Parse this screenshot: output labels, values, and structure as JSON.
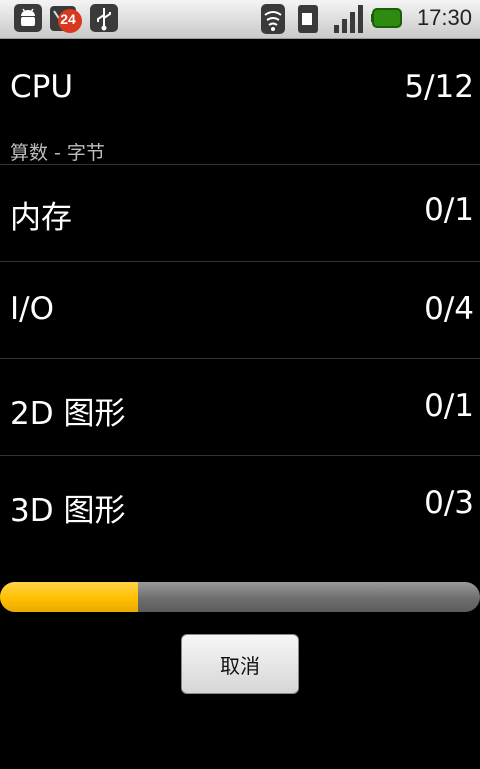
{
  "status_bar": {
    "notification_count": "24",
    "time": "17:30"
  },
  "rows": [
    {
      "label": "CPU",
      "value": "5/12"
    },
    {
      "label": "内存",
      "value": "0/1"
    },
    {
      "label": "I/O",
      "value": "0/4"
    },
    {
      "label": "2D 图形",
      "value": "0/1"
    },
    {
      "label": "3D 图形",
      "value": "0/3"
    }
  ],
  "subtitle": "算数 - 字节",
  "progress": {
    "fraction": 0.287,
    "color": "#ffbf00"
  },
  "cancel_label": "取消",
  "colors": {
    "background": "#000000",
    "text": "#ffffff"
  }
}
